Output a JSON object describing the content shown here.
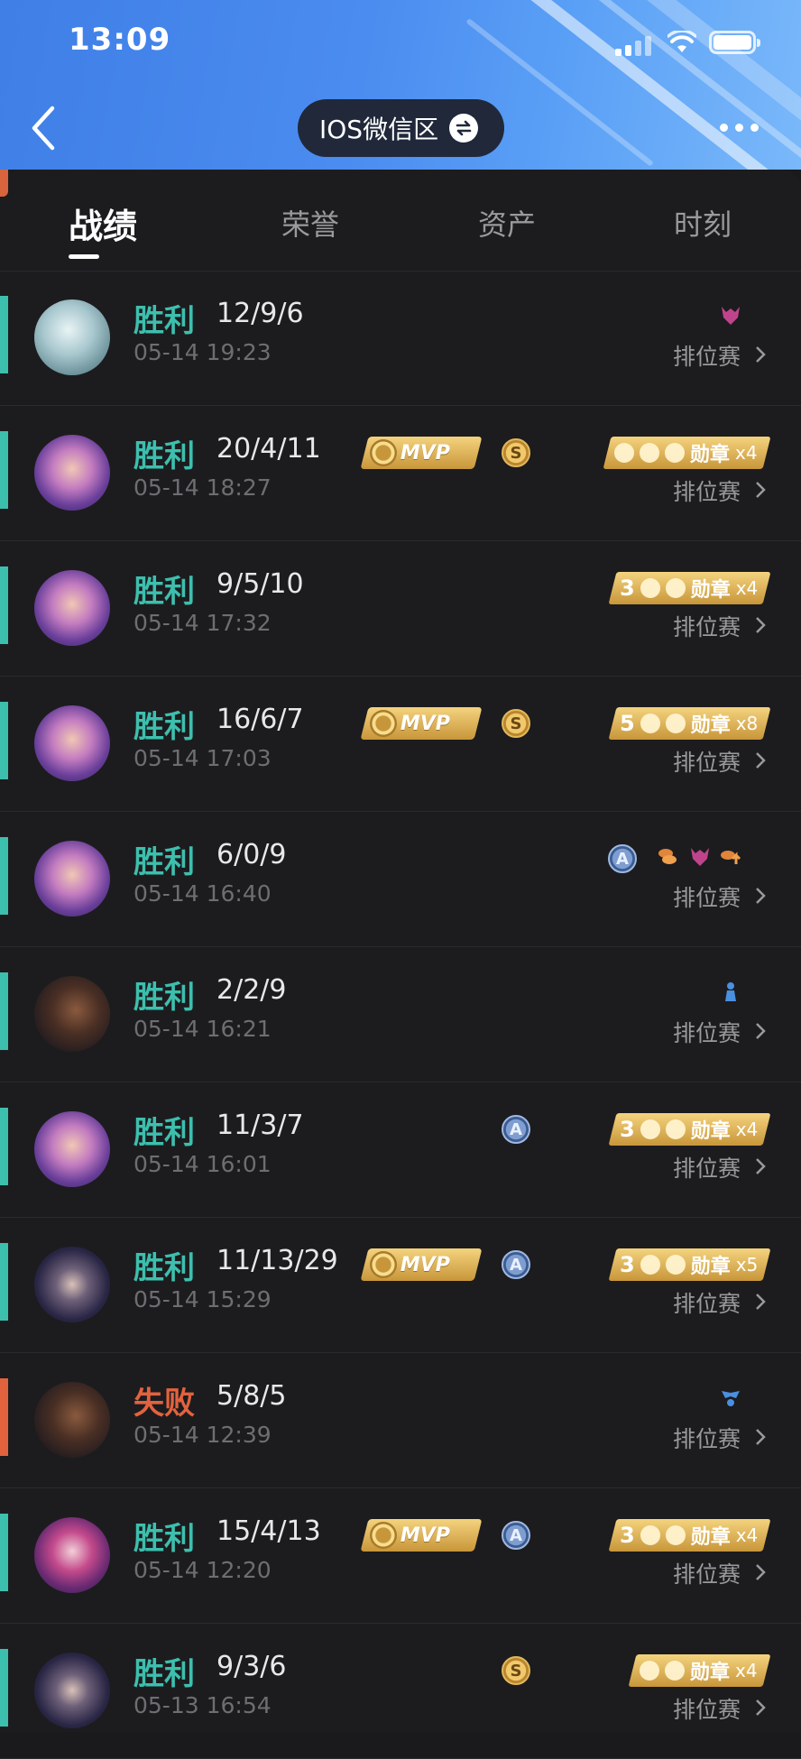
{
  "status_bar": {
    "time": "13:09"
  },
  "header": {
    "server_label": "IOS微信区"
  },
  "tabs": [
    {
      "label": "战绩",
      "active": true
    },
    {
      "label": "荣誉",
      "active": false
    },
    {
      "label": "资产",
      "active": false
    },
    {
      "label": "时刻",
      "active": false
    }
  ],
  "colors": {
    "win": "#3dbfae",
    "loss": "#e3623e",
    "header_blue": "#4b8cf0"
  },
  "matches": [
    {
      "result": "胜利",
      "kda": "12/9/6",
      "time": "05-14 19:23",
      "mode": "排位赛"
    },
    {
      "result": "胜利",
      "kda": "20/4/11",
      "time": "05-14 18:27",
      "mode": "排位赛",
      "medal": "勋章",
      "medal_count": "x4"
    },
    {
      "result": "胜利",
      "kda": "9/5/10",
      "time": "05-14 17:32",
      "mode": "排位赛",
      "medal": "勋章",
      "medal_count": "x4",
      "medal_num": "3"
    },
    {
      "result": "胜利",
      "kda": "16/6/7",
      "time": "05-14 17:03",
      "mode": "排位赛",
      "medal": "勋章",
      "medal_count": "x8",
      "medal_num": "5"
    },
    {
      "result": "胜利",
      "kda": "6/0/9",
      "time": "05-14 16:40",
      "mode": "排位赛"
    },
    {
      "result": "胜利",
      "kda": "2/2/9",
      "time": "05-14 16:21",
      "mode": "排位赛"
    },
    {
      "result": "胜利",
      "kda": "11/3/7",
      "time": "05-14 16:01",
      "mode": "排位赛",
      "medal": "勋章",
      "medal_count": "x4",
      "medal_num": "3"
    },
    {
      "result": "胜利",
      "kda": "11/13/29",
      "time": "05-14 15:29",
      "mode": "排位赛",
      "medal": "勋章",
      "medal_count": "x5",
      "medal_num": "3"
    },
    {
      "result": "失败",
      "kda": "5/8/5",
      "time": "05-14 12:39",
      "mode": "排位赛"
    },
    {
      "result": "胜利",
      "kda": "15/4/13",
      "time": "05-14 12:20",
      "mode": "排位赛",
      "medal": "勋章",
      "medal_count": "x4",
      "medal_num": "3"
    },
    {
      "result": "胜利",
      "kda": "9/3/6",
      "time": "05-13 16:54",
      "mode": "排位赛",
      "medal": "勋章",
      "medal_count": "x4"
    }
  ],
  "badges": {
    "mvp": "MVP",
    "coin_s": "S",
    "coin_a": "A"
  }
}
